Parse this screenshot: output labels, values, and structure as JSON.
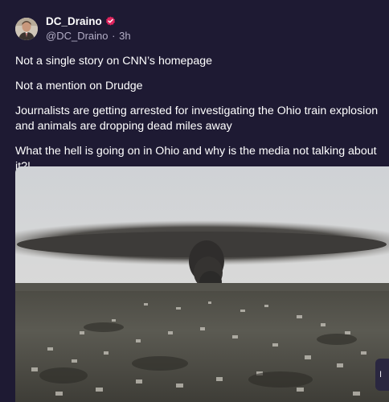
{
  "post": {
    "author_name": "DC_Draino",
    "handle": "@DC_Draino",
    "separator": "·",
    "time_ago": "3h",
    "paragraphs": [
      "Not a single story on CNN’s homepage",
      "Not a mention on Drudge",
      "Journalists are getting arrested for investigating the Ohio train explosion and animals are dropping dead miles away",
      "What the hell is going on in Ohio and why is the media not talking about it?!"
    ],
    "badge_color": "#e0245e",
    "background_color": "#1e1a33"
  },
  "media": {
    "icon": "aerial-photo-smoke-plume"
  },
  "overlay": {
    "label": "I"
  }
}
